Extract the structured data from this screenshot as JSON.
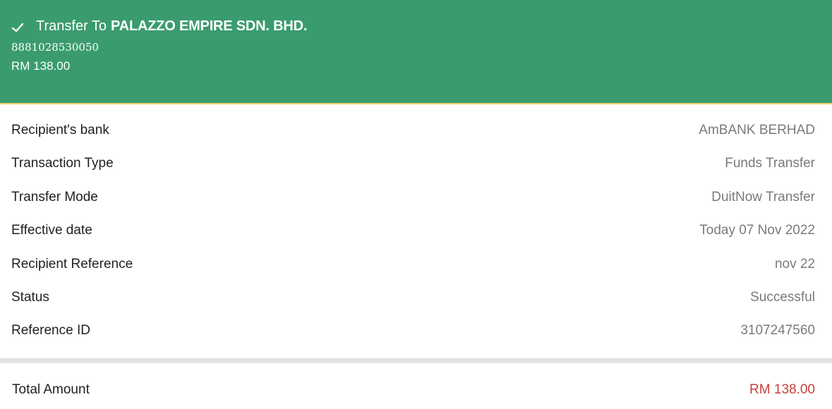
{
  "header": {
    "title_prefix": "Transfer To",
    "recipient_name": "PALAZZO EMPIRE SDN. BHD.",
    "account_number": "8881028530050",
    "amount": "RM 138.00",
    "icon": "checkmark-icon",
    "background_color": "#3a9c6e",
    "accent_color": "#e6d66a"
  },
  "details": [
    {
      "label": "Recipient's bank",
      "value": "AmBANK BERHAD"
    },
    {
      "label": "Transaction Type",
      "value": "Funds Transfer"
    },
    {
      "label": "Transfer Mode",
      "value": "DuitNow Transfer"
    },
    {
      "label": "Effective date",
      "value": "Today 07 Nov 2022"
    },
    {
      "label": "Recipient Reference",
      "value": "nov 22"
    },
    {
      "label": "Status",
      "value": "Successful"
    },
    {
      "label": "Reference ID",
      "value": "3107247560"
    }
  ],
  "total": {
    "label": "Total Amount",
    "value": "RM 138.00",
    "value_color": "#c8403c"
  }
}
